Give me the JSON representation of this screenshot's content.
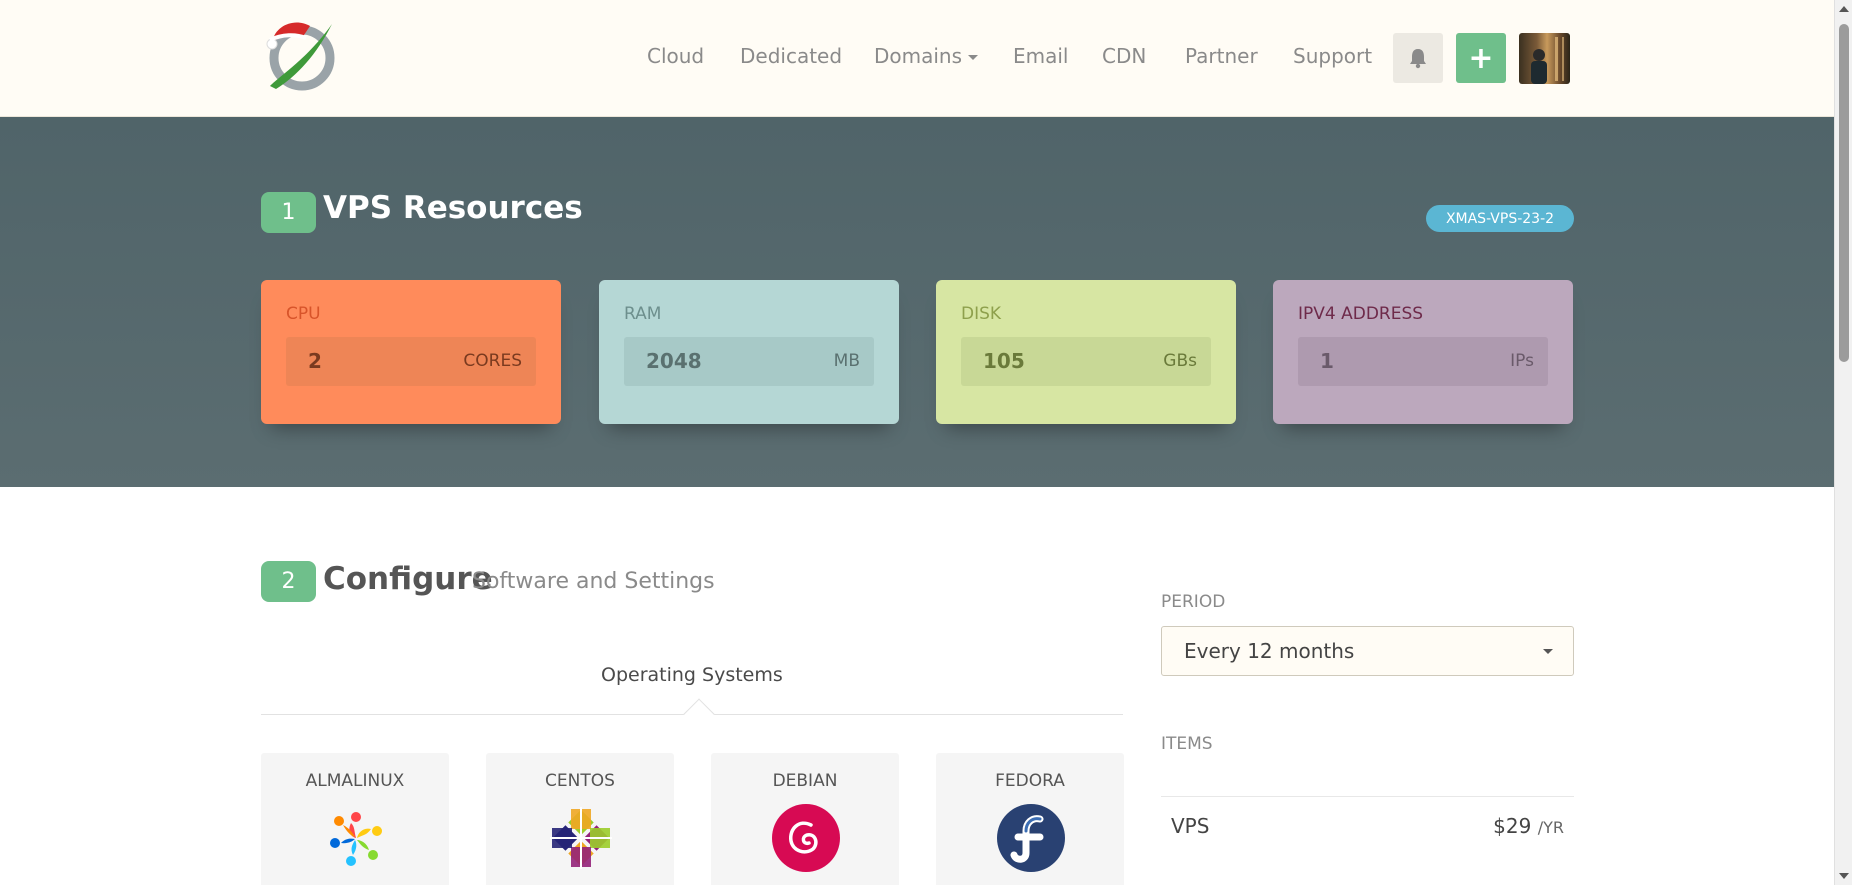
{
  "header": {
    "nav": [
      {
        "label": "Cloud"
      },
      {
        "label": "Dedicated"
      },
      {
        "label": "Domains",
        "has_dropdown": true
      },
      {
        "label": "Email"
      },
      {
        "label": "CDN"
      },
      {
        "label": "Partner"
      },
      {
        "label": "Support"
      }
    ],
    "icons": {
      "bell": "bell-icon",
      "plus": "plus-icon",
      "logo": "santa-hat-logo"
    },
    "plus_label": "+"
  },
  "resources": {
    "step": "1",
    "title": "VPS Resources",
    "plan_tag": "XMAS-VPS-23-2",
    "cards": {
      "cpu": {
        "label": "CPU",
        "value": "2",
        "unit": "CORES"
      },
      "ram": {
        "label": "RAM",
        "value": "2048",
        "unit": "MB"
      },
      "disk": {
        "label": "DISK",
        "value": "105",
        "unit": "GBs"
      },
      "ipv4": {
        "label": "IPV4 ADDRESS",
        "value": "1",
        "unit": "IPs"
      }
    }
  },
  "configure": {
    "step": "2",
    "title": "Configure",
    "subtitle": "Software and Settings",
    "tab": "Operating Systems",
    "os": [
      {
        "name": "ALMALINUX"
      },
      {
        "name": "CENTOS"
      },
      {
        "name": "DEBIAN"
      },
      {
        "name": "FEDORA"
      }
    ]
  },
  "sidebar": {
    "period_label": "PERIOD",
    "period_value": "Every 12 months",
    "items_label": "ITEMS",
    "items": [
      {
        "name": "VPS",
        "price": "$29",
        "period": "/YR"
      }
    ]
  },
  "colors": {
    "accent_green": "#6fbf8b",
    "band": "#536669",
    "tag_blue": "#5bb6d3",
    "cpu": "#ff8b5b",
    "ram": "#b5d7d5",
    "disk": "#d7e6a3",
    "ipv4": "#bca8bd"
  }
}
